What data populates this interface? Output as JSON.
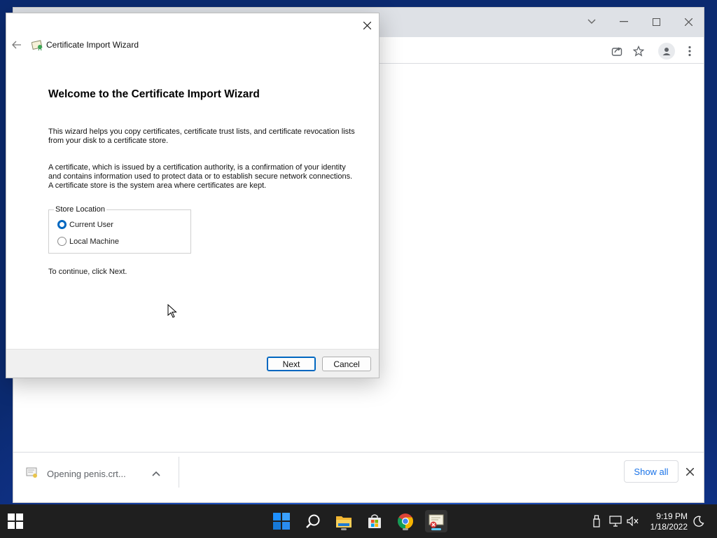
{
  "browser": {
    "downloads": {
      "item_label": "Opening penis.crt...",
      "show_all_label": "Show all"
    }
  },
  "wizard": {
    "title": "Certificate Import Wizard",
    "heading": "Welcome to the Certificate Import Wizard",
    "paragraph1": "This wizard helps you copy certificates, certificate trust lists, and certificate revocation lists from your disk to a certificate store.",
    "paragraph2": "A certificate, which is issued by a certification authority, is a confirmation of your identity and contains information used to protect data or to establish secure network connections. A certificate store is the system area where certificates are kept.",
    "store_location": {
      "legend": "Store Location",
      "options": [
        {
          "label": "Current User",
          "selected": true
        },
        {
          "label": "Local Machine",
          "selected": false
        }
      ]
    },
    "continue_text": "To continue, click Next.",
    "next_label": "Next",
    "cancel_label": "Cancel"
  },
  "taskbar": {
    "time": "9:19 PM",
    "date": "1/18/2022",
    "apps": [
      "start-icon",
      "search-icon",
      "file-explorer-icon",
      "store-icon",
      "chrome-icon",
      "certificate-manager-icon"
    ]
  },
  "colors": {
    "accent": "#0067c0",
    "chrome_link": "#1a73e8",
    "taskbar_bg": "#1f1f1f"
  }
}
